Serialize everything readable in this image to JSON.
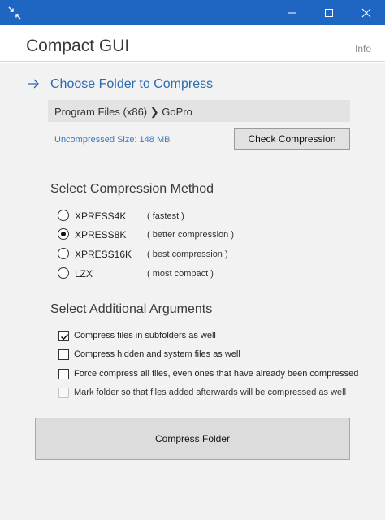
{
  "header": {
    "title": "Compact GUI",
    "info_label": "Info"
  },
  "step1": {
    "title": "Choose Folder to Compress",
    "path": "Program Files (x86) ❯ GoPro",
    "uncompressed_size": "Uncompressed Size: 148 MB",
    "check_button": "Check Compression"
  },
  "method": {
    "title": "Select Compression Method",
    "options": [
      {
        "label": "XPRESS4K",
        "desc": "( fastest )",
        "selected": false
      },
      {
        "label": "XPRESS8K",
        "desc": "( better compression )",
        "selected": true
      },
      {
        "label": "XPRESS16K",
        "desc": "( best compression )",
        "selected": false
      },
      {
        "label": "LZX",
        "desc": "( most compact )",
        "selected": false
      }
    ]
  },
  "args": {
    "title": "Select Additional Arguments",
    "options": [
      {
        "label": "Compress files in subfolders as well",
        "checked": true,
        "enabled": true
      },
      {
        "label": "Compress hidden and system files as well",
        "checked": false,
        "enabled": true
      },
      {
        "label": "Force compress all files, even ones that have already been compressed",
        "checked": false,
        "enabled": true
      },
      {
        "label": "Mark folder so that files added afterwards will be compressed as well",
        "checked": false,
        "enabled": false
      }
    ]
  },
  "compress_button": "Compress Folder",
  "colors": {
    "titlebar": "#1f66c2",
    "accent": "#2b6cb0",
    "content_bg": "#f2f2f2"
  }
}
